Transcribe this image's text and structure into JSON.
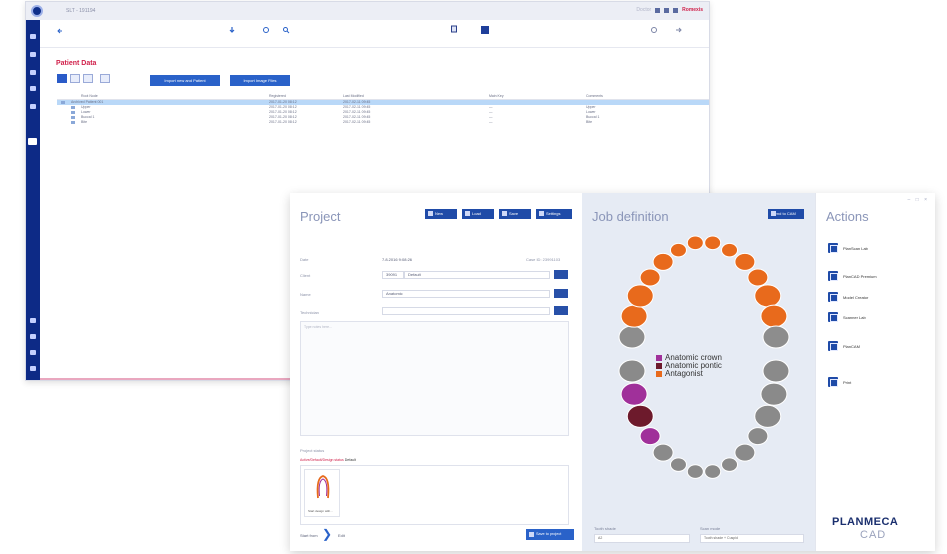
{
  "back_window": {
    "title": "SLT - 191194",
    "user": "Doctor",
    "brand": "Romexis",
    "page_title": "Patient Data",
    "tabs": [
      "",
      "",
      "",
      ""
    ],
    "buttons": [
      "Import new and Patient",
      "Import Image Files"
    ],
    "table": {
      "headers": [
        "Root Node",
        "Registered",
        "Last Modified",
        "Main Key",
        "Comments"
      ],
      "rows": [
        {
          "name": "Archived Patient 001",
          "reg": "2017-01-20 08:12",
          "mod": "2017-02-11 09:45",
          "key": "",
          "comment": ""
        },
        {
          "name": "Upper",
          "reg": "2017-01-20 08:12",
          "mod": "2017-02-11 09:45",
          "key": "—",
          "comment": "Upper"
        },
        {
          "name": "Lower",
          "reg": "2017-01-20 08:12",
          "mod": "2017-02-11 09:45",
          "key": "—",
          "comment": "Lower"
        },
        {
          "name": "Buccal 1",
          "reg": "2017-01-20 08:12",
          "mod": "2017-02-11 09:45",
          "key": "—",
          "comment": "Buccal 1"
        },
        {
          "name": "Bite",
          "reg": "2017-01-20 08:12",
          "mod": "2017-02-11 09:45",
          "key": "—",
          "comment": "Bite"
        }
      ]
    }
  },
  "project": {
    "title": "Project",
    "header_buttons": [
      "New",
      "Load",
      "Save",
      "Settings"
    ],
    "date_label": "Date",
    "date_value": "7.8.2016 9:08:26",
    "case_id": "Case ID: 23991103",
    "client_label": "Client",
    "client_prefix": "39091",
    "client_value": "Default",
    "name_label": "Name",
    "name_value": "Anatomic",
    "technician_label": "Technician",
    "notes_placeholder": "Type notes here...",
    "status_label": "Project status",
    "status_sub": "Active/Default/Design status",
    "status_val": "Default",
    "phase_label": "Start design with...",
    "footer_left": "Start from",
    "footer_after": "Edit",
    "footer_button": "Save to project"
  },
  "job": {
    "title": "Job definition",
    "header_button": "Send to CAM",
    "legend": [
      {
        "label": "Anatomic crown",
        "color": "#a0309a"
      },
      {
        "label": "Anatomic pontic",
        "color": "#6d1a2c"
      },
      {
        "label": "Antagonist",
        "color": "#e86a1c"
      }
    ],
    "tooth_shade_label": "Tooth shade",
    "tooth_shade_value": "A2",
    "scan_mode_label": "Scan mode",
    "scan_mode_value": "Tooth shade + Cuspid"
  },
  "actions": {
    "title": "Actions",
    "items": [
      "PlanScan Lab",
      "PlanCAD Premium",
      "Model Creator",
      "Scanner Lab",
      "PlanCAM",
      "Print"
    ],
    "brand": "PLANMECA",
    "brand_sub": "CAD"
  },
  "colors": {
    "accent": "#2a62c9",
    "brand_red": "#d0204a",
    "nav": "#0d2a86",
    "crown": "#a0309a",
    "pontic": "#6d1a2c",
    "antagonist": "#e86a1c",
    "tooth": "#8a8a8a"
  }
}
